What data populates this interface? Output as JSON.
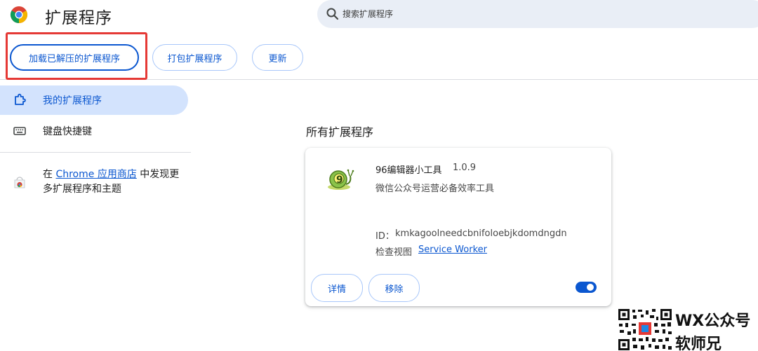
{
  "header": {
    "title": "扩展程序",
    "search_placeholder": "搜索扩展程序"
  },
  "toolbar": {
    "load_unpacked_label": "加载已解压的扩展程序",
    "pack_label": "打包扩展程序",
    "update_label": "更新"
  },
  "sidebar": {
    "items": [
      {
        "label": "我的扩展程序",
        "icon": "extension-puzzle-icon",
        "active": true
      },
      {
        "label": "键盘快捷键",
        "icon": "keyboard-icon",
        "active": false
      }
    ],
    "store_prefix": "在 ",
    "store_link": "Chrome 应用商店",
    "store_suffix": " 中发现更多扩展程序和主题"
  },
  "main": {
    "section_title": "所有扩展程序",
    "extension": {
      "name": "96编辑器小工具",
      "version": "1.0.9",
      "description": "微信公众号运营必备效率工具",
      "id_label": "ID：",
      "id": "kmkagoolneedcbnifoloebjkdomdngdn",
      "inspect_label": "检查视图",
      "service_worker_link": "Service Worker",
      "details_label": "详情",
      "remove_label": "移除",
      "enabled": true
    }
  },
  "watermark": {
    "line1": "WX公众号",
    "line2": "软师兄"
  },
  "colors": {
    "accent": "#0b57d0",
    "active_bg": "#d3e3fd",
    "search_bg": "#e9eef6",
    "highlight": "#e53935"
  }
}
